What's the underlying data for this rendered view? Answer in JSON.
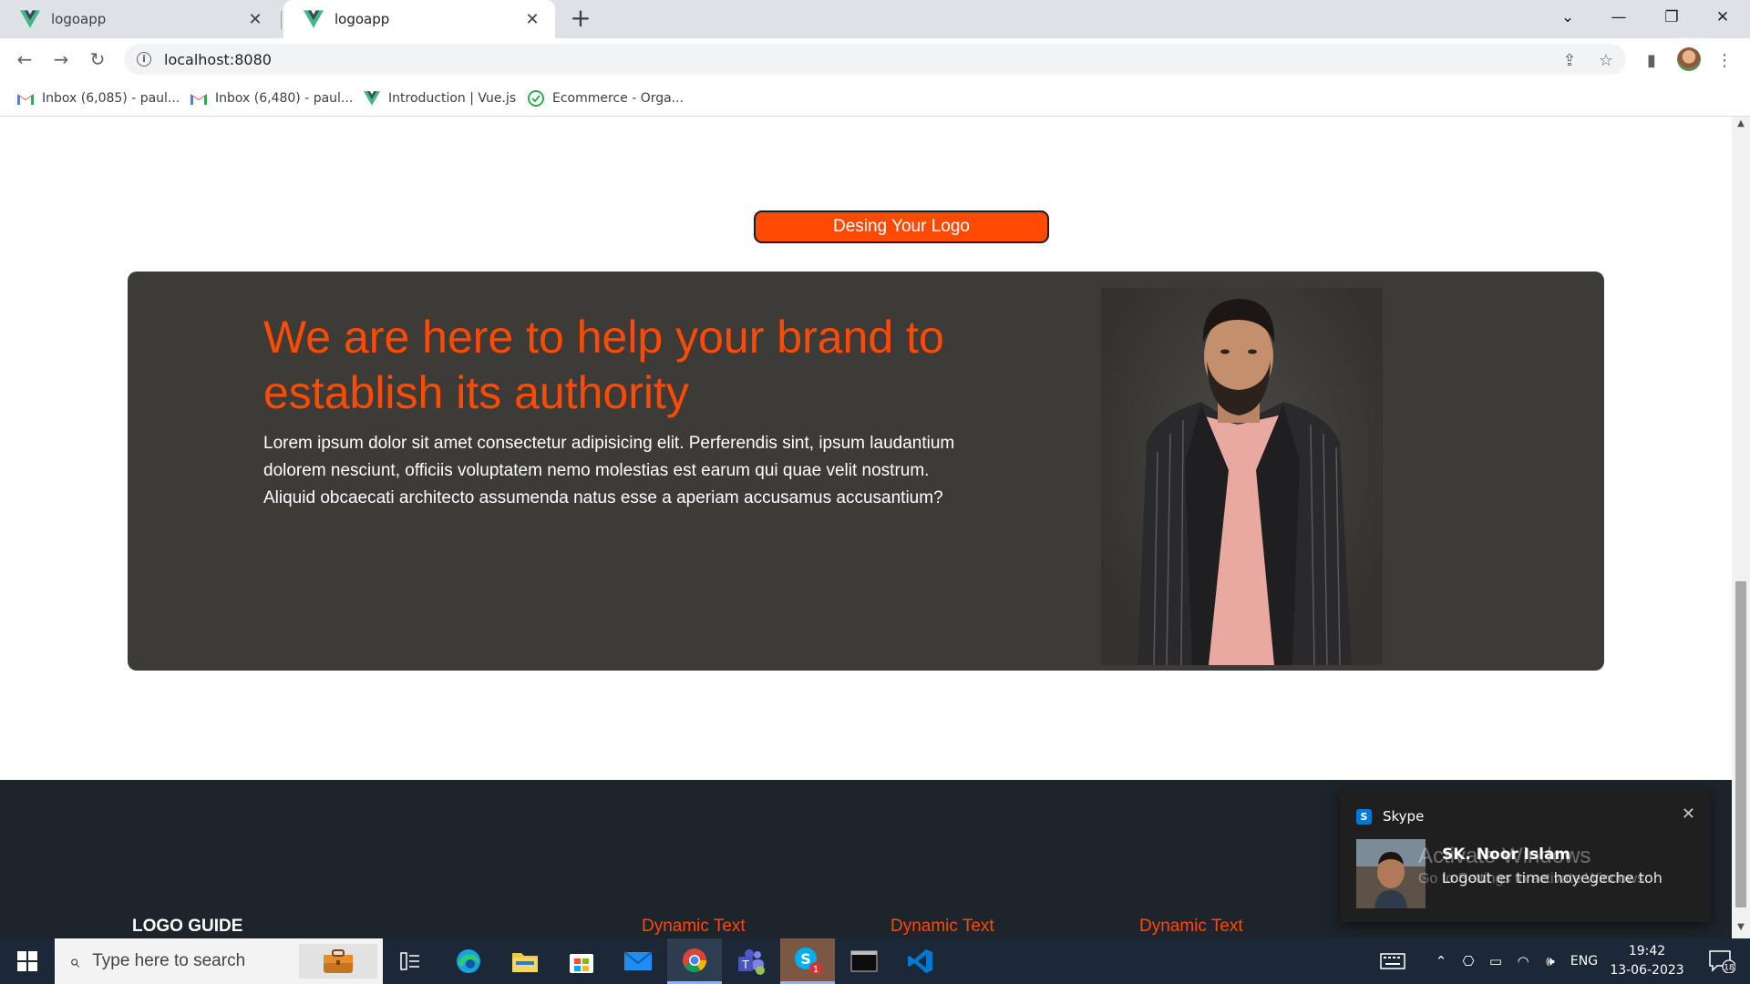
{
  "browser": {
    "tabs": [
      {
        "title": "logoapp",
        "active": false
      },
      {
        "title": "logoapp",
        "active": true
      }
    ],
    "url": "localhost:8080",
    "bookmarks": [
      {
        "label": "Inbox (6,085) - paul...",
        "icon": "gmail-icon"
      },
      {
        "label": "Inbox (6,480) - paul...",
        "icon": "gmail-icon"
      },
      {
        "label": "Introduction | Vue.js",
        "icon": "vue-icon"
      },
      {
        "label": "Ecommerce - Orga...",
        "icon": "ecommerce-icon"
      }
    ]
  },
  "page": {
    "cta_label": "Desing Your Logo",
    "hero": {
      "heading": "We are here to help your brand to establish its authority",
      "body": "Lorem ipsum dolor sit amet consectetur adipisicing elit. Perferendis sint, ipsum laudantium dolorem nesciunt, officiis voluptatem nemo molestias est earum qui quae velit nostrum. Aliquid obcaecati architecto assumenda natus esse a aperiam accusamus accusantium?"
    },
    "footer": {
      "title": "LOGO GUIDE",
      "columns": [
        "Dynamic Text",
        "Dynamic Text",
        "Dynamic Text"
      ]
    }
  },
  "notification": {
    "app": "Skype",
    "sender": "SK. Noor Islam",
    "message": "Logout er time hoyegeche toh"
  },
  "watermark": {
    "line1": "Activate Windows",
    "line2": "Go to Settings to activate Windows."
  },
  "taskbar": {
    "search_placeholder": "Type here to search",
    "language": "ENG",
    "time": "19:42",
    "date": "13-06-2023",
    "notification_count": "18",
    "skype_badge": "1"
  },
  "colors": {
    "accent": "#ff4a04",
    "hero_bg": "#3c3b37",
    "footer_bg": "#1d242b",
    "taskbar_bg": "#1c2838"
  }
}
